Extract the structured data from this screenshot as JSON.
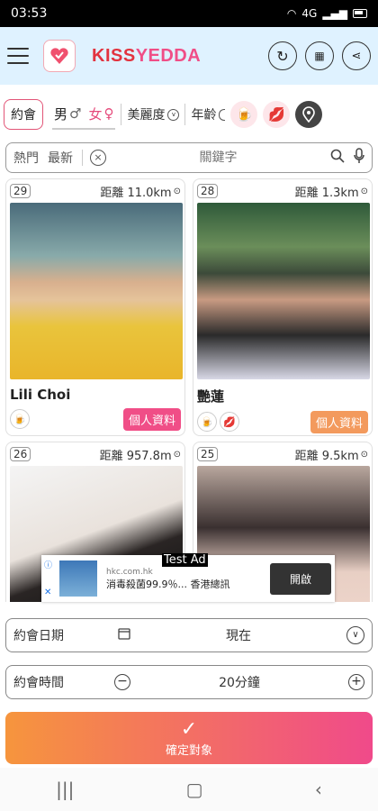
{
  "status": {
    "time": "03:53",
    "signal": "4G"
  },
  "app": {
    "brand_a": "KISS",
    "brand_b": "YEDDA"
  },
  "filters": {
    "date_chip": "約會",
    "male": "男",
    "female": "女",
    "beauty": "美麗度",
    "age": "年齡"
  },
  "search": {
    "sort_hot": "熱門",
    "sort_new": "最新",
    "placeholder": "關鍵字"
  },
  "cards": [
    {
      "age": "29",
      "distance": "距離 11.0km",
      "name": "Lili Choi",
      "profile": "個人資料"
    },
    {
      "age": "28",
      "distance": "距離 1.3km",
      "name": "艷蓮",
      "profile": "個人資料"
    },
    {
      "age": "26",
      "distance": "距離 957.8m"
    },
    {
      "age": "25",
      "distance": "距離 9.5km"
    }
  ],
  "ad": {
    "badge": "Test Ad",
    "host": "hkc.com.hk",
    "text": "消毒殺菌99.9％... 香港總訊",
    "button": "開啟"
  },
  "date_row": {
    "label": "約會日期",
    "value": "現在"
  },
  "time_row": {
    "label": "約會時間",
    "value": "20分鐘"
  },
  "confirm": {
    "check": "✓",
    "label": "確定對象"
  },
  "colors": {
    "accent_pink": "#f04e87",
    "brand_red": "#e2333f",
    "orange": "#f39a5d"
  }
}
